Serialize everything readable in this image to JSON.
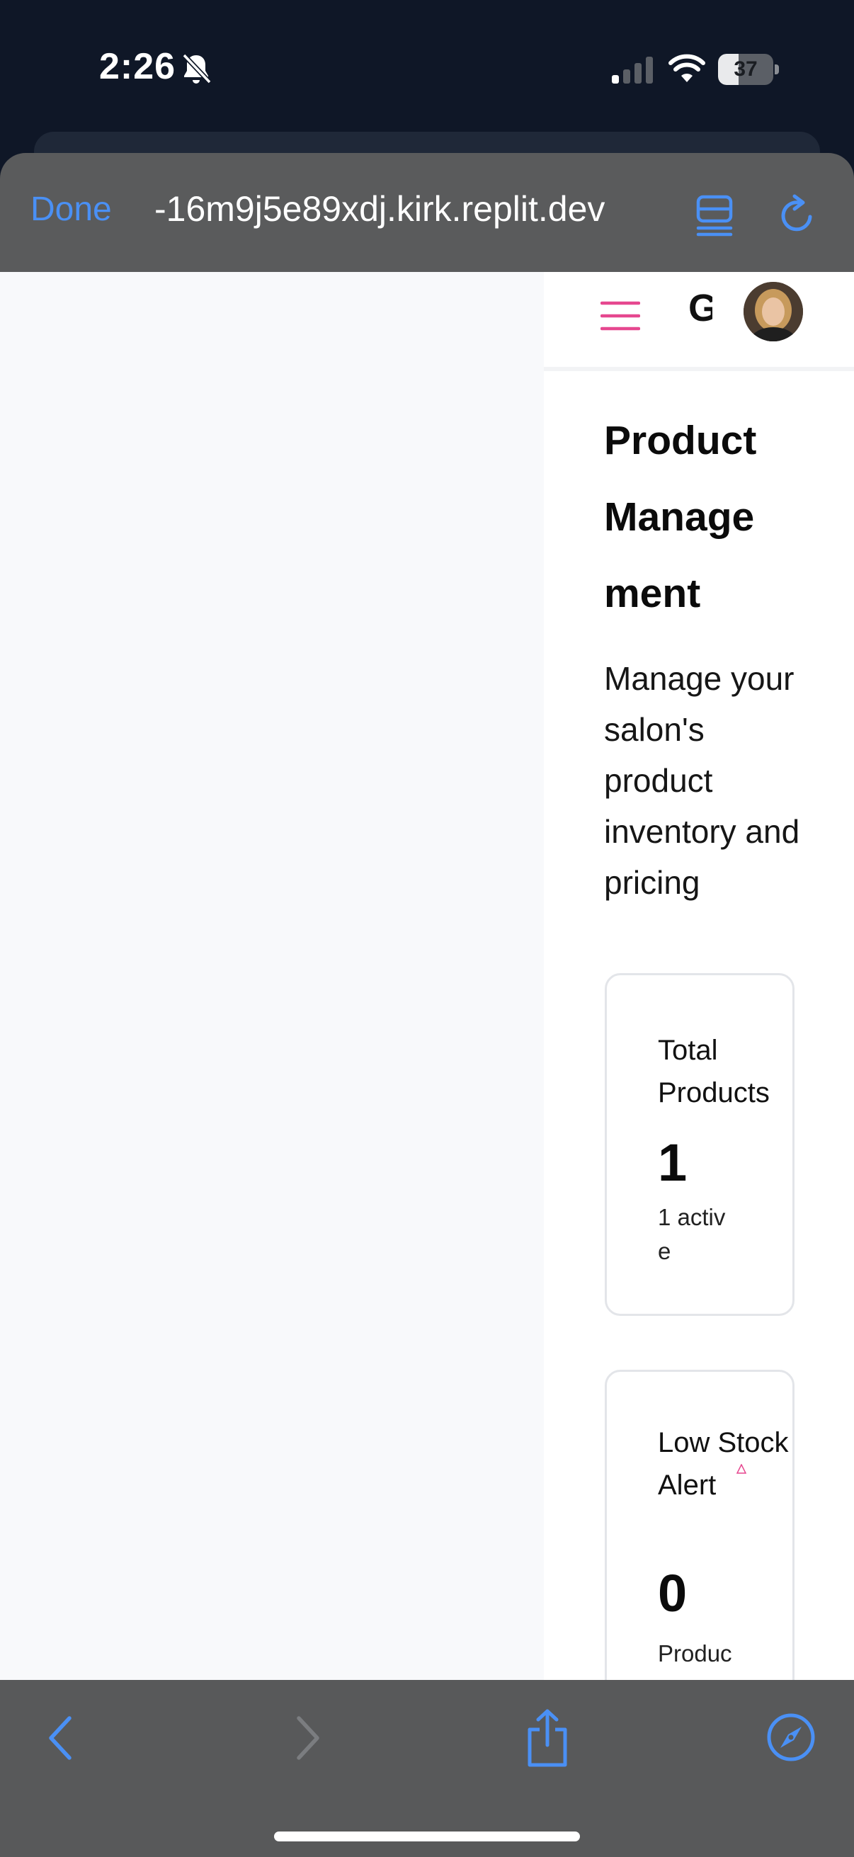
{
  "status_bar": {
    "time": "2:26",
    "battery_level": "37",
    "battery_fraction": 0.37,
    "icons": [
      "bell-slash-icon",
      "cellular-signal-icon",
      "wifi-icon",
      "battery-icon"
    ]
  },
  "browser": {
    "done_label": "Done",
    "url": "-16m9j5e89xdj.kirk.replit.dev",
    "accent_color": "#4a90f5",
    "top_icons": [
      "reader-view-icon",
      "reload-icon"
    ],
    "bottom_icons": [
      "back-icon",
      "forward-icon",
      "share-icon",
      "compass-icon"
    ]
  },
  "app": {
    "header": {
      "brand_letter": "G",
      "menu_color": "#e6478f",
      "icons": [
        "hamburger-menu-icon",
        "avatar"
      ]
    },
    "page": {
      "title": "Product Management",
      "subtitle": "Manage your salon's product inventory and pricing"
    },
    "stats": [
      {
        "label": "Total Products",
        "value": "1",
        "note": "1 active"
      },
      {
        "label": "Low Stock Alert",
        "value": "0",
        "note": "Products"
      }
    ]
  }
}
